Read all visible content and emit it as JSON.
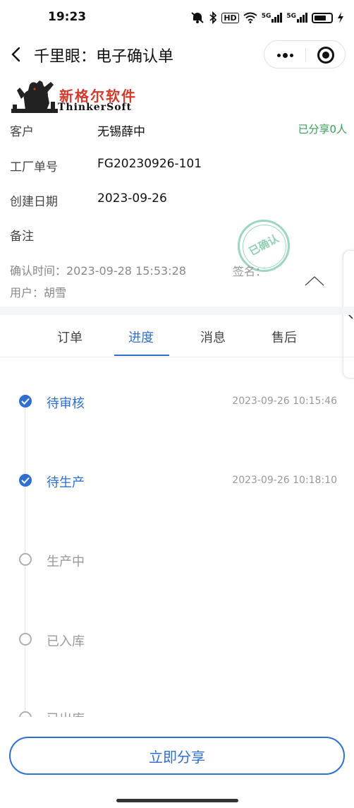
{
  "status_bar": {
    "time": "19:23",
    "icons": [
      "mute-icon",
      "bluetooth-icon",
      "hd-icon",
      "wifi-icon",
      "5g-signal-icon",
      "5g-signal-icon",
      "battery-icon",
      "charging-icon"
    ],
    "hd_label": "HD",
    "net1": "5G",
    "net2": "5G"
  },
  "nav": {
    "title": "千里眼：电子确认单"
  },
  "logo": {
    "cn": "新格尔软件",
    "en": "ThinkerSoft"
  },
  "info": {
    "customer_label": "客户",
    "customer_value": "无锡薛中",
    "share_status": "已分享0人",
    "factory_no_label": "工厂单号",
    "factory_no_value": "FG20230926-101",
    "created_label": "创建日期",
    "created_value": "2023-09-26",
    "remark_label": "备注",
    "confirm_time": "确认时间：2023-09-28 15:53:28",
    "sign_label": "签名：",
    "user": "用户：胡雪",
    "stamp_text": "已确认"
  },
  "tabs": [
    {
      "label": "订单"
    },
    {
      "label": "进度"
    },
    {
      "label": "消息"
    },
    {
      "label": "售后"
    }
  ],
  "active_tab": "进度",
  "timeline": [
    {
      "label": "待审核",
      "time": "2023-09-26 10:15:46",
      "done": true
    },
    {
      "label": "待生产",
      "time": "2023-09-26 10:18:10",
      "done": true
    },
    {
      "label": "生产中",
      "time": "",
      "done": false
    },
    {
      "label": "已入库",
      "time": "",
      "done": false
    },
    {
      "label": "已出库",
      "time": "",
      "done": false
    }
  ],
  "bottom": {
    "share_button": "立即分享"
  },
  "colors": {
    "accent": "#2f6fd0",
    "share_green": "#3a9e57",
    "logo_red": "#d33a2c",
    "stamp_green": "#7cc9a6"
  }
}
